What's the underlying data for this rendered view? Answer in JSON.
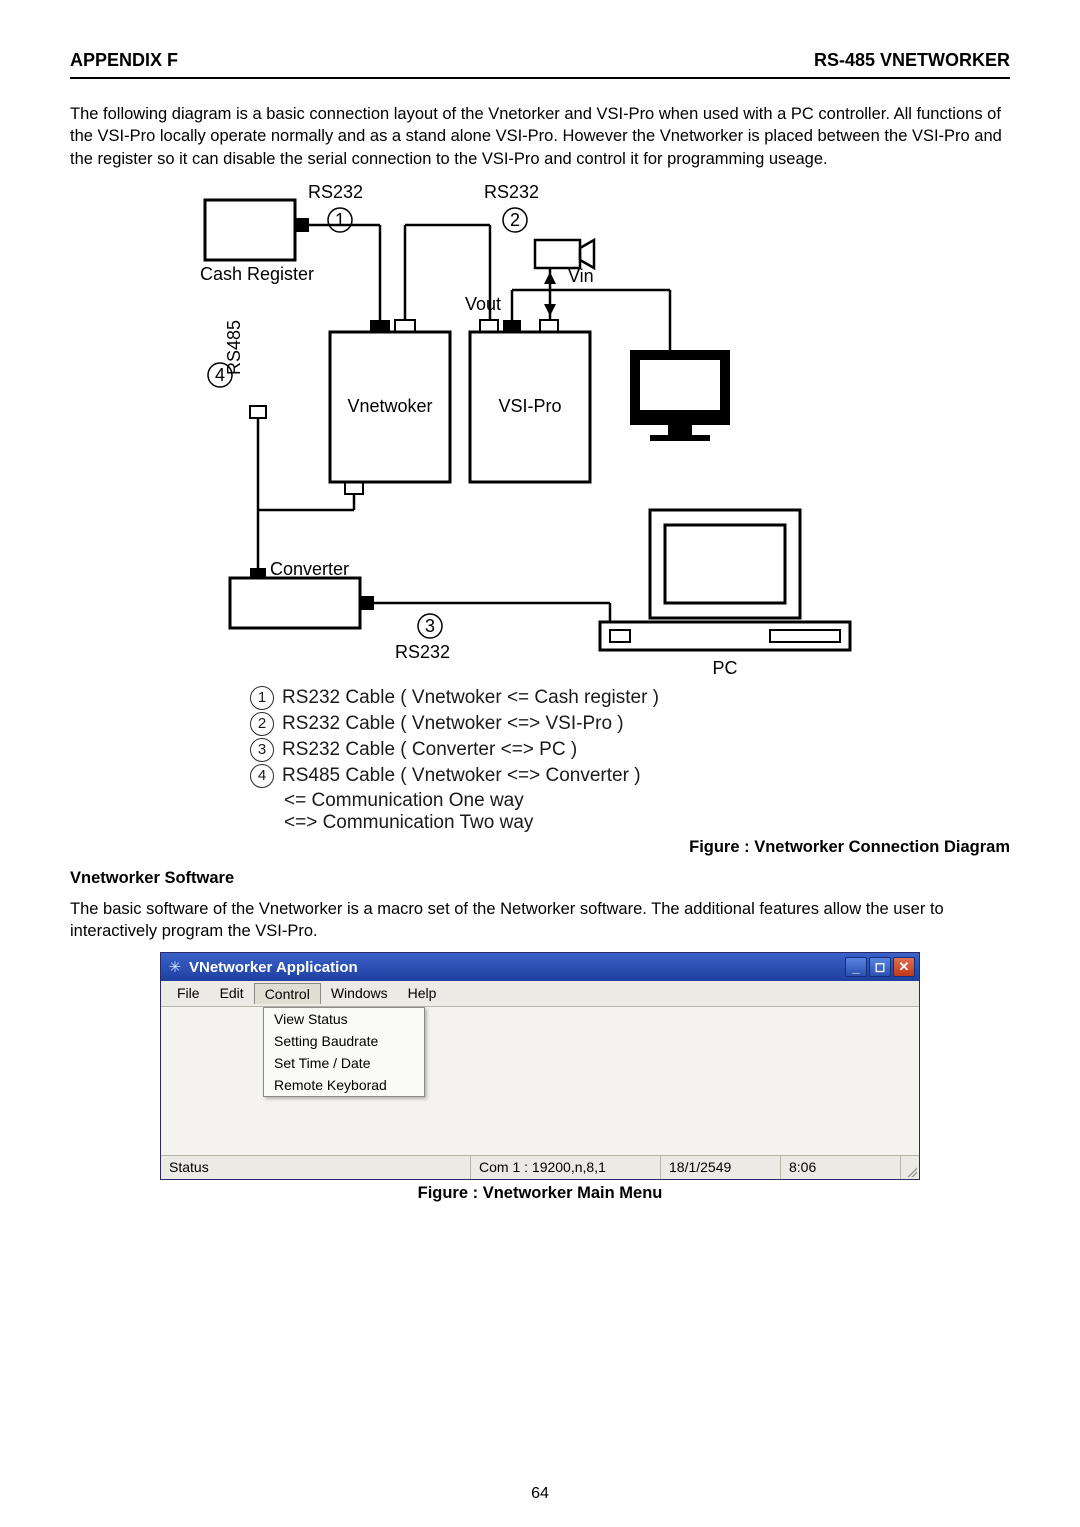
{
  "header": {
    "left": "APPENDIX F",
    "right": "RS-485 VNETWORKER"
  },
  "intro_para": "The following diagram is a basic connection layout of the Vnetorker and VSI-Pro when used with a PC controller. All functions of the VSI-Pro locally operate normally and as a stand alone VSI-Pro. However the Vnetworker is placed between the VSI-Pro and the register so it can disable the serial connection to the VSI-Pro and control it for programming useage.",
  "diagram": {
    "labels": {
      "rs232_1": "RS232",
      "rs232_2": "RS232",
      "rs232_3": "RS232",
      "rs485": "RS485",
      "cash_register": "Cash Register",
      "vin": "Vin",
      "vout": "Vout",
      "vnetwoker": "Vnetwoker",
      "vsi_pro": "VSI-Pro",
      "converter": "Converter",
      "pc": "PC",
      "n1": "1",
      "n2": "2",
      "n3": "3",
      "n4": "4"
    }
  },
  "legend": {
    "items": [
      {
        "num": "1",
        "text": "RS232 Cable ( Vnetwoker <= Cash register )"
      },
      {
        "num": "2",
        "text": "RS232 Cable ( Vnetwoker <=> VSI-Pro )"
      },
      {
        "num": "3",
        "text": "RS232 Cable ( Converter <=> PC )"
      },
      {
        "num": "4",
        "text": "RS485 Cable ( Vnetwoker <=> Converter )"
      }
    ],
    "one_way": "<=   Communication One way",
    "two_way": "<=> Communication Two way"
  },
  "figure1_caption": "Figure : Vnetworker Connection Diagram",
  "software_hdr": "Vnetworker Software",
  "software_para": "The basic software of the Vnetworker is a macro set of the Networker software. The additional features allow the user to interactively program the VSI-Pro.",
  "app": {
    "title": "VNetworker Application",
    "menu": [
      "File",
      "Edit",
      "Control",
      "Windows",
      "Help"
    ],
    "control_menu": [
      "View Status",
      "Setting Baudrate",
      "Set Time / Date",
      "Remote Keyborad"
    ],
    "status": {
      "label": "Status",
      "com": "Com 1 : 19200,n,8,1",
      "date": "18/1/2549",
      "time": "8:06"
    }
  },
  "figure2_caption": "Figure : Vnetworker Main Menu",
  "page_number": "64"
}
